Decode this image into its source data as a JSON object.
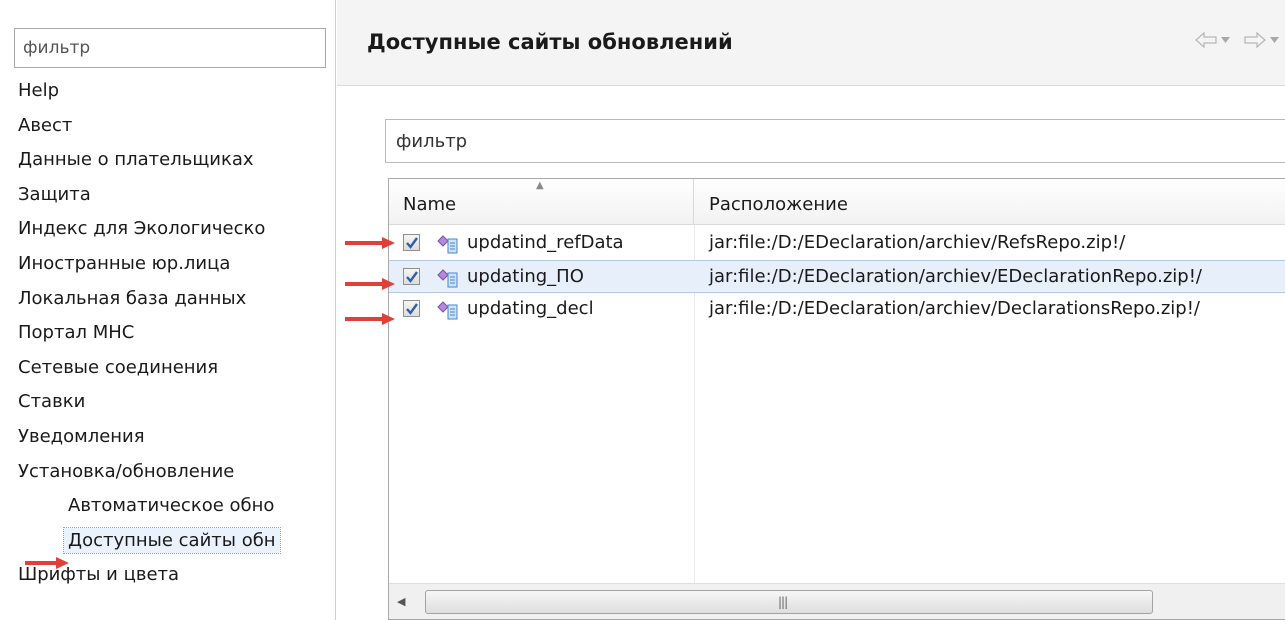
{
  "left_pane": {
    "filter_placeholder": "фильтр",
    "tree": [
      {
        "label": "Help",
        "level": 0
      },
      {
        "label": "Авест",
        "level": 0
      },
      {
        "label": "Данные о плательщиках",
        "level": 0
      },
      {
        "label": "Защита",
        "level": 0
      },
      {
        "label": "Индекс для Экологическо",
        "level": 0
      },
      {
        "label": "Иностранные юр.лица",
        "level": 0
      },
      {
        "label": "Локальная база данных",
        "level": 0
      },
      {
        "label": "Портал МНС",
        "level": 0
      },
      {
        "label": "Сетевые соединения",
        "level": 0
      },
      {
        "label": "Ставки",
        "level": 0
      },
      {
        "label": "Уведомления",
        "level": 0
      },
      {
        "label": "Установка/обновление",
        "level": 0
      },
      {
        "label": "Автоматическое обно",
        "level": 1
      },
      {
        "label": "Доступные сайты обн",
        "level": 1,
        "selected": true
      },
      {
        "label": "Шрифты и цвета",
        "level": 0
      }
    ]
  },
  "page": {
    "title": "Доступные сайты обновлений",
    "filter_placeholder": "фильтр",
    "nav": {
      "back_icon": "back-arrow-icon",
      "forward_icon": "forward-arrow-icon"
    }
  },
  "table": {
    "columns": [
      "Name",
      "Расположение"
    ],
    "sorted_column": "Name",
    "rows": [
      {
        "checked": true,
        "name": "updatind_refData",
        "location": "jar:file:/D:/EDeclaration/archiev/RefsRepo.zip!/",
        "selected": false
      },
      {
        "checked": true,
        "name": "updating_ПО",
        "location": "jar:file:/D:/EDeclaration/archiev/EDeclarationRepo.zip!/",
        "selected": true
      },
      {
        "checked": true,
        "name": "updating_decl",
        "location": "jar:file:/D:/EDeclaration/archiev/DeclarationsRepo.zip!/",
        "selected": false
      }
    ]
  },
  "colors": {
    "annotation_arrow": "#e0403a",
    "selection": "#e6effa",
    "checkbox_check": "#2f5fa8",
    "site_icon": "#9a6cc8"
  }
}
